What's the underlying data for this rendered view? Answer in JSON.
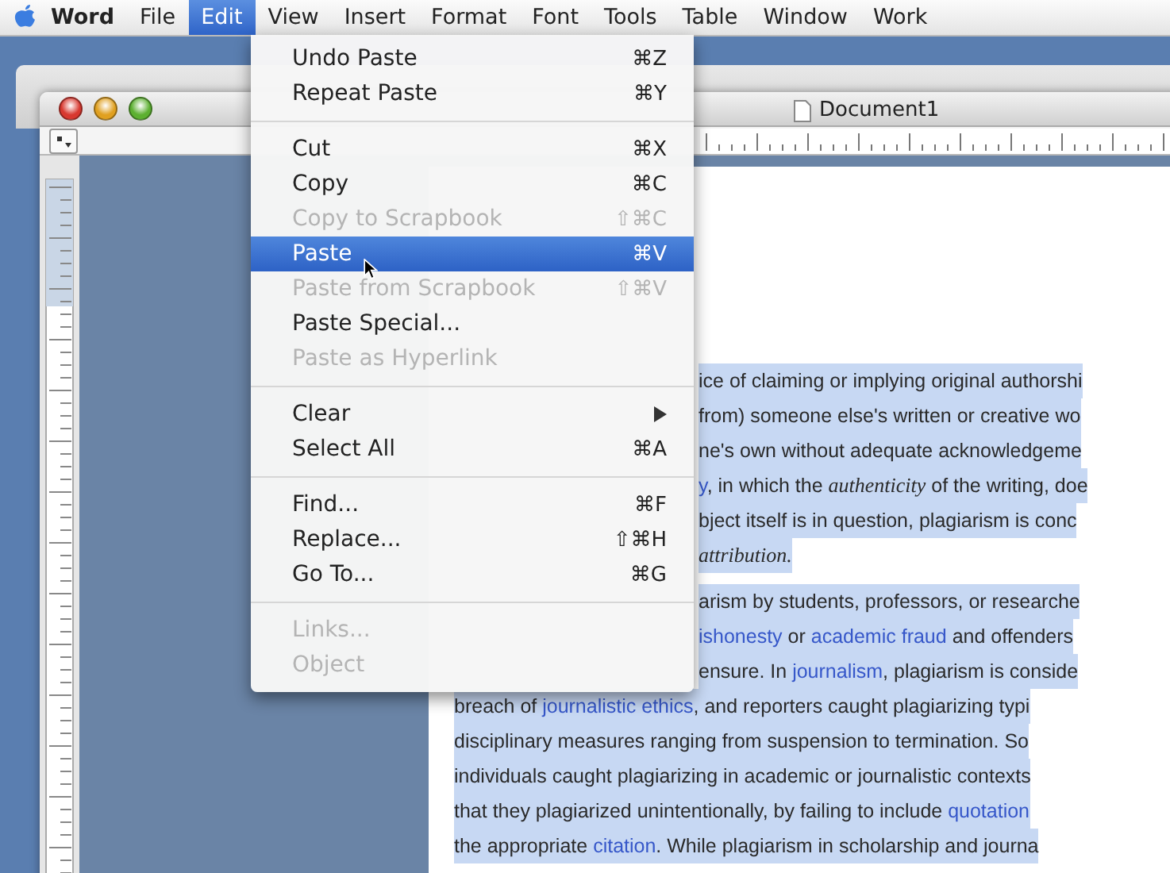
{
  "menu_bar": {
    "items": [
      {
        "label": "Word",
        "kind": "app",
        "selected": false
      },
      {
        "label": "File",
        "kind": "menu",
        "selected": false
      },
      {
        "label": "Edit",
        "kind": "menu",
        "selected": true
      },
      {
        "label": "View",
        "kind": "menu",
        "selected": false
      },
      {
        "label": "Insert",
        "kind": "menu",
        "selected": false
      },
      {
        "label": "Format",
        "kind": "menu",
        "selected": false
      },
      {
        "label": "Font",
        "kind": "menu",
        "selected": false
      },
      {
        "label": "Tools",
        "kind": "menu",
        "selected": false
      },
      {
        "label": "Table",
        "kind": "menu",
        "selected": false
      },
      {
        "label": "Window",
        "kind": "menu",
        "selected": false
      },
      {
        "label": "Work",
        "kind": "menu",
        "selected": false
      }
    ]
  },
  "edit_menu": {
    "groups": [
      [
        {
          "label": "Undo Paste",
          "shortcut": "⌘Z",
          "disabled": false,
          "selected": false
        },
        {
          "label": "Repeat Paste",
          "shortcut": "⌘Y",
          "disabled": false,
          "selected": false
        }
      ],
      [
        {
          "label": "Cut",
          "shortcut": "⌘X",
          "disabled": false,
          "selected": false
        },
        {
          "label": "Copy",
          "shortcut": "⌘C",
          "disabled": false,
          "selected": false
        },
        {
          "label": "Copy to Scrapbook",
          "shortcut": "⇧⌘C",
          "disabled": true,
          "selected": false
        },
        {
          "label": "Paste",
          "shortcut": "⌘V",
          "disabled": false,
          "selected": true
        },
        {
          "label": "Paste from Scrapbook",
          "shortcut": "⇧⌘V",
          "disabled": true,
          "selected": false
        },
        {
          "label": "Paste Special...",
          "disabled": false,
          "selected": false
        },
        {
          "label": "Paste as Hyperlink",
          "disabled": true,
          "selected": false
        }
      ],
      [
        {
          "label": "Clear",
          "submenu": true,
          "disabled": false,
          "selected": false
        },
        {
          "label": "Select All",
          "shortcut": "⌘A",
          "disabled": false,
          "selected": false
        }
      ],
      [
        {
          "label": "Find...",
          "shortcut": "⌘F",
          "disabled": false,
          "selected": false
        },
        {
          "label": "Replace...",
          "shortcut": "⇧⌘H",
          "disabled": false,
          "selected": false
        },
        {
          "label": "Go To...",
          "shortcut": "⌘G",
          "disabled": false,
          "selected": false
        }
      ],
      [
        {
          "label": "Links...",
          "disabled": true,
          "selected": false
        },
        {
          "label": "Object",
          "disabled": true,
          "selected": false
        }
      ]
    ]
  },
  "window": {
    "title": "Document1"
  },
  "document": {
    "selected": true,
    "paragraphs_beside_menu": [
      [
        [
          {
            "text": "ice of claiming or implying original authorshi",
            "kind": "plain"
          }
        ],
        [
          {
            "text": "from) someone else's written or creative wo",
            "kind": "plain"
          }
        ],
        [
          {
            "text": "ne's own without adequate acknowledgeme",
            "kind": "plain"
          }
        ],
        [
          {
            "text": "y",
            "kind": "link"
          },
          {
            "text": ", in which the ",
            "kind": "plain"
          },
          {
            "text": "authenticity",
            "kind": "italic"
          },
          {
            "text": " of the writing, doe",
            "kind": "plain"
          }
        ],
        [
          {
            "text": "bject itself is in question, plagiarism is conc",
            "kind": "plain"
          }
        ],
        [
          {
            "text": "attribution.",
            "kind": "italic"
          }
        ]
      ],
      [
        [
          {
            "text": "arism by students, professors, or researche",
            "kind": "plain"
          }
        ],
        [
          {
            "text": "ishonesty",
            "kind": "link"
          },
          {
            "text": " or ",
            "kind": "plain"
          },
          {
            "text": "academic fraud",
            "kind": "link"
          },
          {
            "text": " and offenders",
            "kind": "plain"
          }
        ],
        [
          {
            "text": "ensure. In ",
            "kind": "plain"
          },
          {
            "text": "journalism",
            "kind": "link"
          },
          {
            "text": ", plagiarism is conside",
            "kind": "plain"
          }
        ]
      ]
    ],
    "lines": [
      [
        {
          "text": "breach of ",
          "kind": "plain"
        },
        {
          "text": "journalistic ethics",
          "kind": "link"
        },
        {
          "text": ", and reporters caught plagiarizing typi",
          "kind": "plain"
        }
      ],
      [
        {
          "text": "disciplinary measures ranging from suspension to termination. So",
          "kind": "plain"
        }
      ],
      [
        {
          "text": "individuals caught plagiarizing in academic or journalistic contexts",
          "kind": "plain"
        }
      ],
      [
        {
          "text": "that they plagiarized unintentionally, by failing to include ",
          "kind": "plain"
        },
        {
          "text": "quotation",
          "kind": "link"
        }
      ],
      [
        {
          "text": "the appropriate ",
          "kind": "plain"
        },
        {
          "text": "citation",
          "kind": "link"
        },
        {
          "text": ". While plagiarism in scholarship and journa",
          "kind": "plain"
        }
      ]
    ]
  }
}
